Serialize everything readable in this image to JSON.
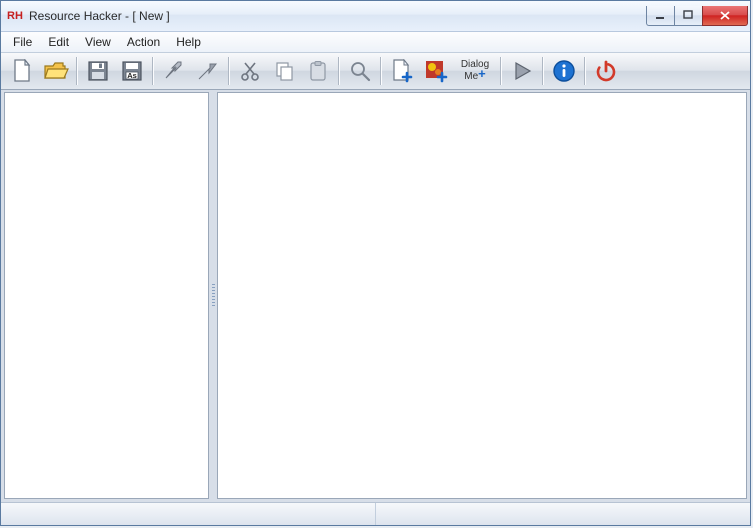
{
  "title": "Resource Hacker - [ New ]",
  "menus": {
    "file": "File",
    "edit": "Edit",
    "view": "View",
    "action": "Action",
    "help": "Help"
  },
  "toolbar": {
    "dialog_label_line1": "Dialog",
    "dialog_label_line2": "Me"
  }
}
